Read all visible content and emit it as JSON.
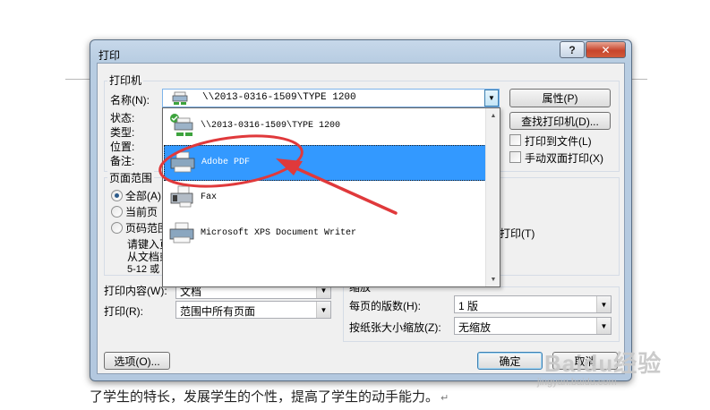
{
  "document": {
    "bottom_text": "了学生的特长，发展学生的个性，提高了学生的动手能力。",
    "paragraph_mark": "↵"
  },
  "dialog": {
    "title": "打印",
    "help_button": "?",
    "close_button": "✕",
    "printer_group": {
      "label": "打印机",
      "name_label": "名称(N):",
      "status_label": "状态:",
      "type_label": "类型:",
      "where_label": "位置:",
      "comment_label": "备注:",
      "selected_printer": "\\\\2013-0316-1509\\TYPE 1200",
      "properties_button": "属性(P)",
      "find_printer_button": "查找打印机(D)...",
      "print_to_file": "打印到文件(L)",
      "manual_duplex": "手动双面打印(X)"
    },
    "printer_list": [
      {
        "name": "\\\\2013-0316-1509\\TYPE 1200",
        "icon": "network-printer-icon",
        "selected": false
      },
      {
        "name": "Adobe PDF",
        "icon": "printer-icon",
        "selected": true
      },
      {
        "name": "Fax",
        "icon": "fax-icon",
        "selected": false
      },
      {
        "name": "Microsoft XPS Document Writer",
        "icon": "printer-icon",
        "selected": false
      }
    ],
    "page_range": {
      "label": "页面范围",
      "all": "全部(A)",
      "current_page": "当前页",
      "pages": "页码范围",
      "hint_line1": "请键入页",
      "hint_line2": "从文档或",
      "hint_line3": "5-12 或"
    },
    "collate_fragment": "打印(T)",
    "print_what_label": "打印内容(W):",
    "print_what_value": "文档",
    "print_label": "打印(R):",
    "print_value": "范围中所有页面",
    "zoom": {
      "label": "缩放",
      "pages_per_sheet_label": "每页的版数(H):",
      "pages_per_sheet_value": "1 版",
      "scale_to_paper_label": "按纸张大小缩放(Z):",
      "scale_to_paper_value": "无缩放"
    },
    "options_button": "选项(O)...",
    "ok_button": "确定",
    "cancel_button": "取消"
  },
  "annotation": {
    "color": "#e0393b"
  },
  "watermark": {
    "brand": "Baidu经验",
    "url": "jingyan.baidu.com"
  }
}
